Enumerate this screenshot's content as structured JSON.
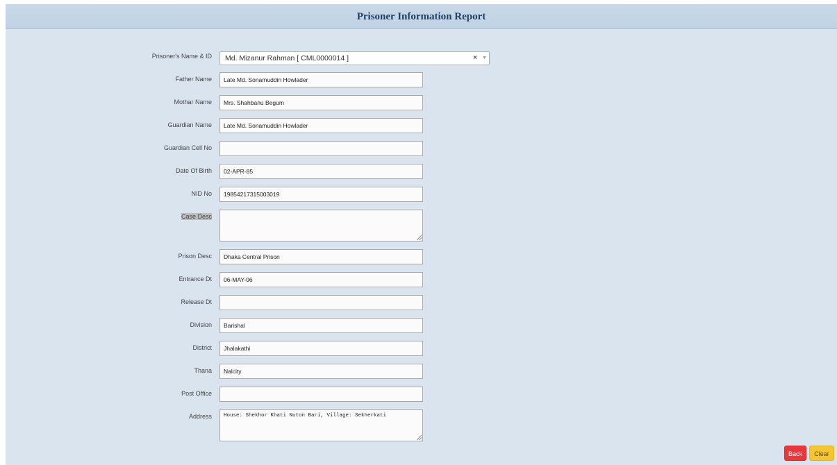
{
  "header": {
    "title": "Prisoner Information Report"
  },
  "prisoner_select": {
    "label": "Prisoner's Name & ID",
    "value": "Md. Mizanur Rahman [ CML0000014 ]",
    "clear_glyph": "×",
    "arrow_glyph": "▼"
  },
  "fields": {
    "father_name": {
      "label": "Father Name",
      "value": "Late Md. Sonamuddin Howlader"
    },
    "mother_name": {
      "label": "Mothar Name",
      "value": "Mrs. Shahbanu Begum"
    },
    "guardian_name": {
      "label": "Guardian Name",
      "value": "Late Md. Sonamuddin Howlader"
    },
    "guardian_cell": {
      "label": "Guardian Cell No",
      "value": ""
    },
    "dob": {
      "label": "Date Of Birth",
      "value": "02-APR-85"
    },
    "nid": {
      "label": "NID No",
      "value": "19854217315003019"
    },
    "case_desc": {
      "label": "Case Desc",
      "value": ""
    },
    "prison_desc": {
      "label": "Prison Desc",
      "value": "Dhaka Central Prison"
    },
    "entrance_dt": {
      "label": "Entrance Dt",
      "value": "06-MAY-06"
    },
    "release_dt": {
      "label": "Release Dt",
      "value": ""
    },
    "division": {
      "label": "Division",
      "value": "Barishal"
    },
    "district": {
      "label": "District",
      "value": "Jhalakathi"
    },
    "thana": {
      "label": "Thana",
      "value": "Nalcity"
    },
    "post_office": {
      "label": "Post Office",
      "value": ""
    },
    "address": {
      "label": "Address",
      "value": "House: Shekhor Khati Nuton Bari, Village: Sekherkati"
    }
  },
  "buttons": {
    "back": "Back",
    "clear": "Clear"
  },
  "colors": {
    "page_bg": "#d9e4ef",
    "header_bg": "#c5d6e7",
    "title": "#1f3f66",
    "back_button": "#e8383b",
    "clear_button": "#f6c533"
  }
}
